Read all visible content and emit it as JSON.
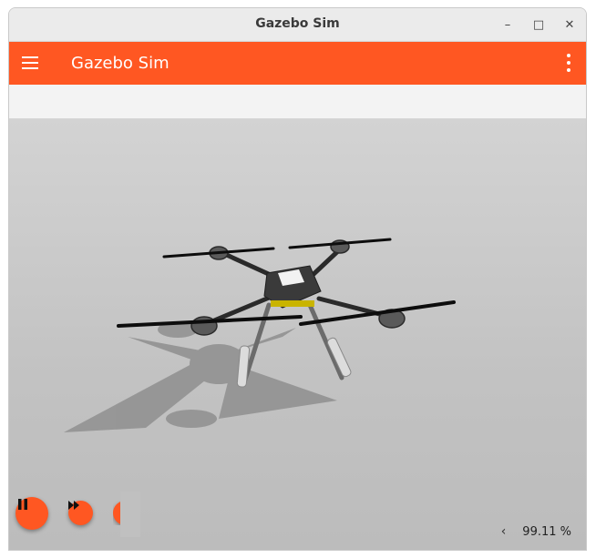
{
  "window": {
    "title": "Gazebo Sim",
    "controls": {
      "minimize": "–",
      "maximize": "□",
      "close": "✕"
    }
  },
  "appbar": {
    "title": "Gazebo Sim",
    "menu_icon": "hamburger-menu-icon",
    "overflow_icon": "vertical-dots-icon"
  },
  "playback": {
    "pause_icon": "pause-icon",
    "step_icon": "fast-forward-icon"
  },
  "stats": {
    "collapse_icon": "chevron-left-icon",
    "real_time_factor": "99.11 %"
  },
  "colors": {
    "accent": "#ff5722",
    "background": "#f3f3f3",
    "scene_ground": "#c8c8c8"
  }
}
